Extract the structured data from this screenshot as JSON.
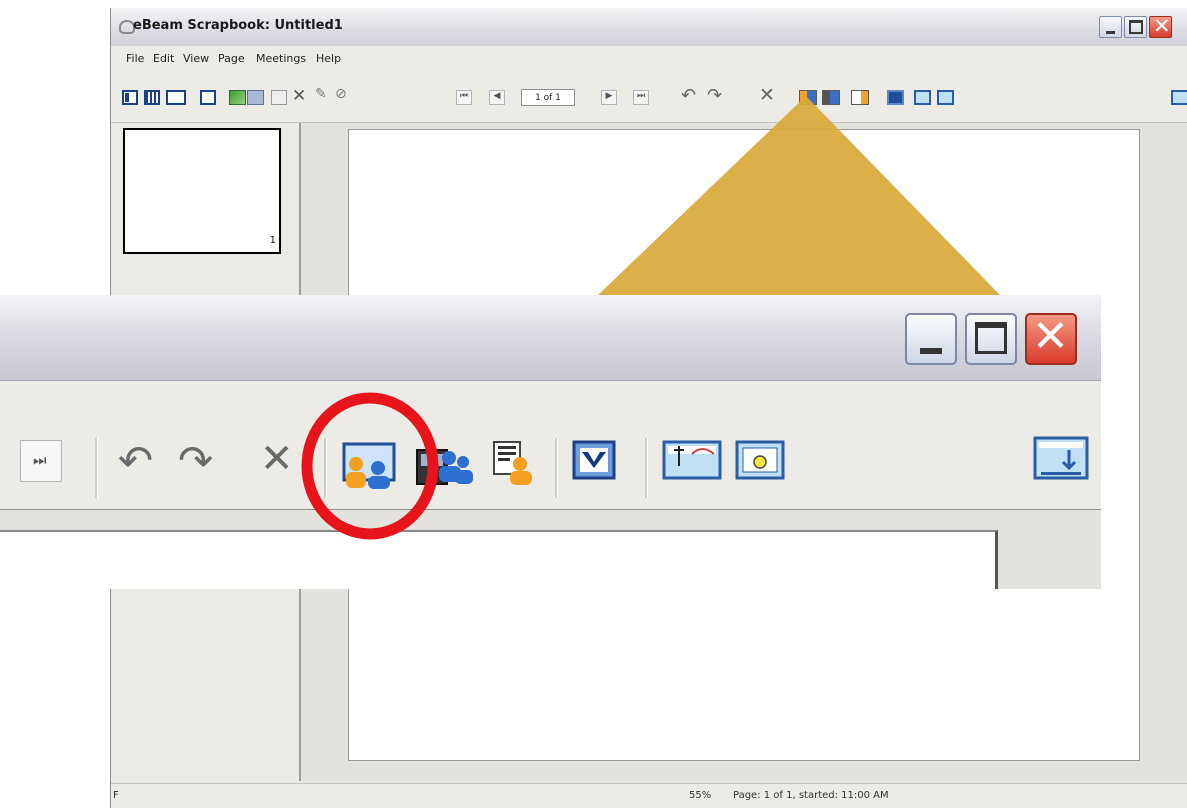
{
  "window": {
    "title": "eBeam Scrapbook: Untitled1",
    "menu": [
      "File",
      "Edit",
      "View",
      "Page",
      "Meetings",
      "Help"
    ]
  },
  "toolbar": {
    "page_indicator": "1 of 1"
  },
  "thumbnails": [
    {
      "number": "1"
    }
  ],
  "status": {
    "left": "F",
    "zoom": "55%",
    "page_info": "Page: 1 of 1, started: 11:00 AM"
  },
  "colors": {
    "callout": "#d9a93a",
    "highlight_ring": "#e8141c",
    "close_button": "#d83a2a"
  },
  "icons": {
    "zoomed_toolbar": [
      "last-page-icon",
      "undo-icon",
      "redo-icon",
      "delete-icon",
      "share-meeting-icon",
      "join-meeting-icon",
      "meeting-notes-icon",
      "capture-icon",
      "projection-area-icon",
      "record-icon",
      "download-icon"
    ]
  }
}
